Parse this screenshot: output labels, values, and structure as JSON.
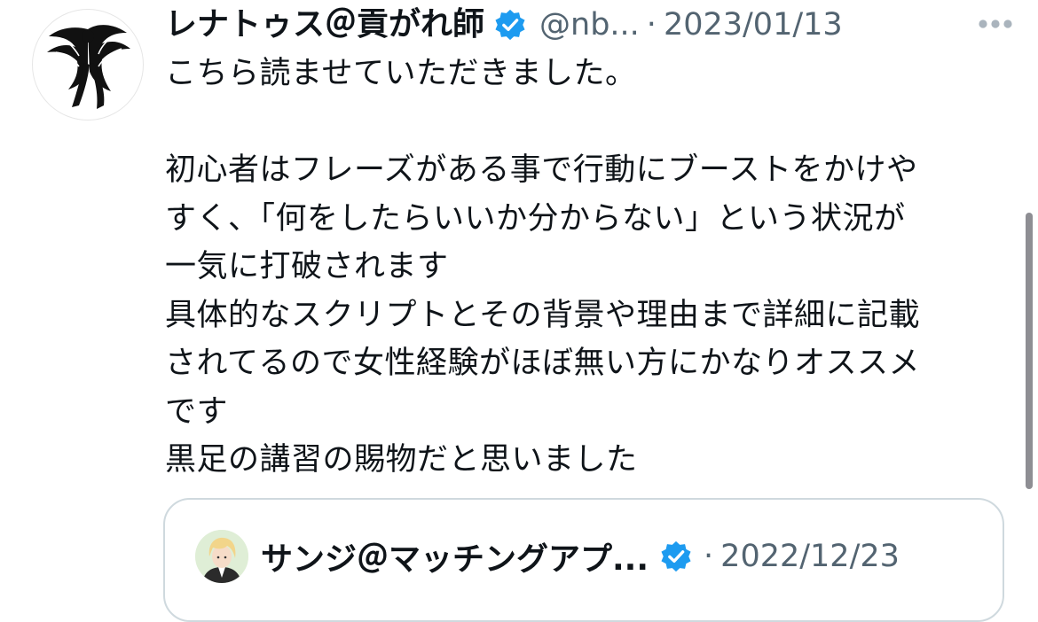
{
  "tweet": {
    "display_name": "レナトゥス＠貢がれ師",
    "handle": "@nb...",
    "separator": "·",
    "date": "2023/01/13",
    "avatar_icon": "phoenix-avatar-icon",
    "verified_icon": "verified-badge-icon",
    "more_icon": "more-options-icon",
    "lines": {
      "l1": "こちら読ませていただきました。",
      "l2": "初心者はフレーズがある事で行動にブーストをかけや",
      "l3": "すく、「何をしたらいいか分からない」という状況が",
      "l4": "一気に打破されます",
      "l5": "具体的なスクリプトとその背景や理由まで詳細に記載",
      "l6": "されてるので女性経験がほぼ無い方にかなりオススメ",
      "l7": "です",
      "l8": "黒足の講習の賜物だと思いました"
    }
  },
  "quoted": {
    "display_name": "サンジ＠マッチングアプ...",
    "separator": "·",
    "date": "2022/12/23",
    "avatar_icon": "anime-avatar-icon",
    "verified_icon": "verified-badge-icon"
  },
  "colors": {
    "text": "#0f1419",
    "secondary": "#536471",
    "verified": "#1d9bf0",
    "card_border": "#cfd9de"
  }
}
